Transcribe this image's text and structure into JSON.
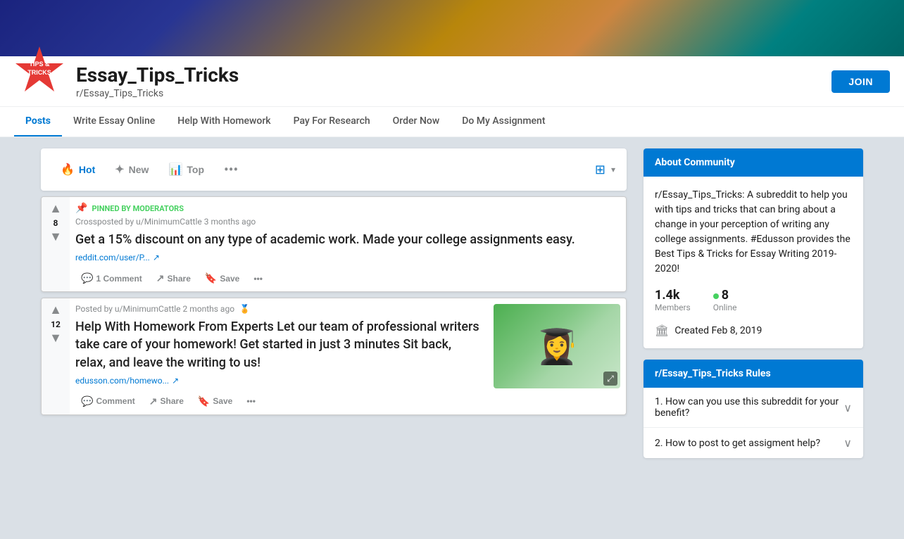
{
  "banner": {},
  "header": {
    "subreddit_name": "Essay_Tips_Tricks",
    "subreddit_handle": "r/Essay_Tips_Tricks",
    "join_label": "JOIN",
    "logo_text_line1": "TIPS &",
    "logo_text_line2": "TRICKS"
  },
  "nav": {
    "tabs": [
      {
        "label": "Posts",
        "active": true
      },
      {
        "label": "Write Essay Online",
        "active": false
      },
      {
        "label": "Help With Homework",
        "active": false
      },
      {
        "label": "Pay For Research",
        "active": false
      },
      {
        "label": "Order Now",
        "active": false
      },
      {
        "label": "Do My Assignment",
        "active": false
      }
    ]
  },
  "sort": {
    "hot_label": "Hot",
    "new_label": "New",
    "top_label": "Top",
    "more_label": "•••"
  },
  "posts": [
    {
      "pinned": true,
      "pinned_label": "PINNED BY MODERATORS",
      "crosspost_text": "Crossposted by u/MinimumCattle 3 months ago",
      "vote_count": "8",
      "title": "Get a 15% discount on any type of academic work. Made your college assignments easy.",
      "link_text": "reddit.com/user/P...",
      "actions": [
        {
          "label": "1 Comment",
          "icon": "💬"
        },
        {
          "label": "Share",
          "icon": "↗"
        },
        {
          "label": "Save",
          "icon": "🔖"
        },
        {
          "label": "•••",
          "icon": ""
        }
      ],
      "has_thumbnail": false
    },
    {
      "pinned": false,
      "meta_text": "Posted by u/MinimumCattle 2 months ago",
      "vote_count": "12",
      "title": "Help With Homework From Experts Let our team of professional writers take care of your homework! Get started in just 3 minutes Sit back, relax, and leave the writing to us!",
      "link_text": "edusson.com/homewo...",
      "actions": [
        {
          "label": "Comment",
          "icon": "💬"
        },
        {
          "label": "Share",
          "icon": "↗"
        },
        {
          "label": "Save",
          "icon": "🔖"
        },
        {
          "label": "•••",
          "icon": ""
        }
      ],
      "has_thumbnail": true,
      "thumbnail_alt": "Graduate student in cap and gown"
    }
  ],
  "sidebar": {
    "about": {
      "header": "About Community",
      "description": "r/Essay_Tips_Tricks: A subreddit to help you with tips and tricks that can bring about a change in your perception of writing any college assignments. #Edusson provides the Best Tips & Tricks for Essay Writing 2019-2020!",
      "members_count": "1.4k",
      "members_label": "Members",
      "online_count": "8",
      "online_label": "Online",
      "created_label": "Created Feb 8, 2019"
    },
    "rules": {
      "header": "r/Essay_Tips_Tricks Rules",
      "items": [
        {
          "number": "1.",
          "text": "How can you use this subreddit for your benefit?"
        },
        {
          "number": "2.",
          "text": "How to post to get assigment help?"
        }
      ]
    }
  }
}
